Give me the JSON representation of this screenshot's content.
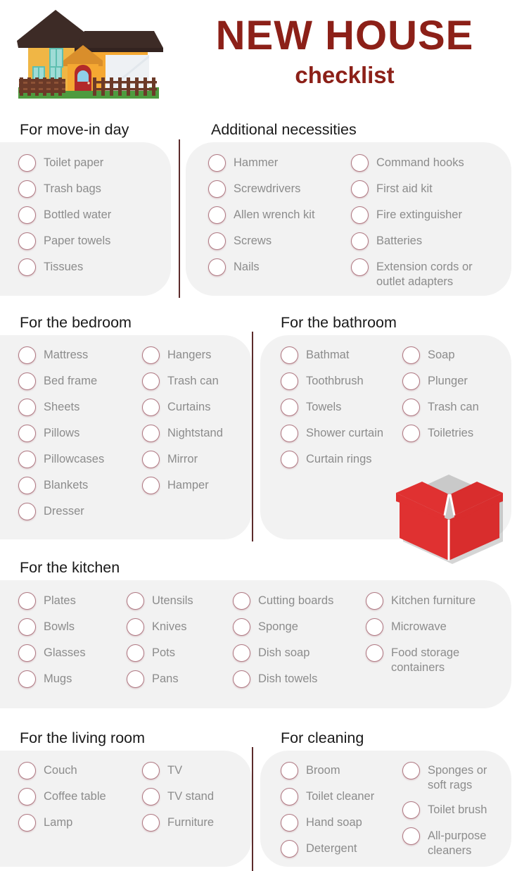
{
  "header": {
    "title_main": "NEW HOUSE",
    "title_sub": "checklist",
    "title_color": "#8c2018",
    "house_icon": "house-illustration-icon",
    "box_icon": "moving-box-icon"
  },
  "theme": {
    "card_bg": "#f2f2f2",
    "checkbox_border": "#b07a84",
    "divider": "#5c2b2b",
    "heading_color": "#1a1a1a",
    "label_color": "#8c8c8c"
  },
  "sections": [
    {
      "id": "move-in-day",
      "heading": "For move-in day",
      "columns": [
        [
          "Toilet paper",
          "Trash bags",
          "Bottled water",
          "Paper towels",
          "Tissues"
        ]
      ]
    },
    {
      "id": "additional-necessities",
      "heading": "Additional necessities",
      "columns": [
        [
          "Hammer",
          "Screwdrivers",
          "Allen wrench kit",
          "Screws",
          "Nails"
        ],
        [
          "Command hooks",
          "First aid kit",
          "Fire extinguisher",
          "Batteries",
          "Extension cords or outlet adapters"
        ]
      ]
    },
    {
      "id": "bedroom",
      "heading": "For the bedroom",
      "columns": [
        [
          "Mattress",
          "Bed frame",
          "Sheets",
          "Pillows",
          "Pillowcases",
          "Blankets",
          "Dresser"
        ],
        [
          "Hangers",
          "Trash can",
          "Curtains",
          "Nightstand",
          "Mirror",
          "Hamper"
        ]
      ]
    },
    {
      "id": "bathroom",
      "heading": "For the bathroom",
      "columns": [
        [
          "Bathmat",
          "Toothbrush",
          "Towels",
          "Shower curtain",
          "Curtain rings"
        ],
        [
          "Soap",
          "Plunger",
          "Trash can",
          "Toiletries"
        ]
      ]
    },
    {
      "id": "kitchen",
      "heading": "For the kitchen",
      "columns": [
        [
          "Plates",
          "Bowls",
          "Glasses",
          "Mugs"
        ],
        [
          "Utensils",
          "Knives",
          "Pots",
          "Pans"
        ],
        [
          "Cutting boards",
          "Sponge",
          "Dish soap",
          "Dish towels"
        ],
        [
          "Kitchen furniture",
          "Microwave",
          "Food storage containers"
        ]
      ]
    },
    {
      "id": "living-room",
      "heading": "For the living room",
      "columns": [
        [
          "Couch",
          "Coffee table",
          "Lamp"
        ],
        [
          "TV",
          "TV stand",
          "Furniture"
        ]
      ]
    },
    {
      "id": "cleaning",
      "heading": "For cleaning",
      "columns": [
        [
          "Broom",
          "Toilet cleaner",
          "Hand soap",
          "Detergent"
        ],
        [
          "Sponges or soft rags",
          "Toilet brush",
          "All-purpose cleaners"
        ]
      ]
    }
  ]
}
